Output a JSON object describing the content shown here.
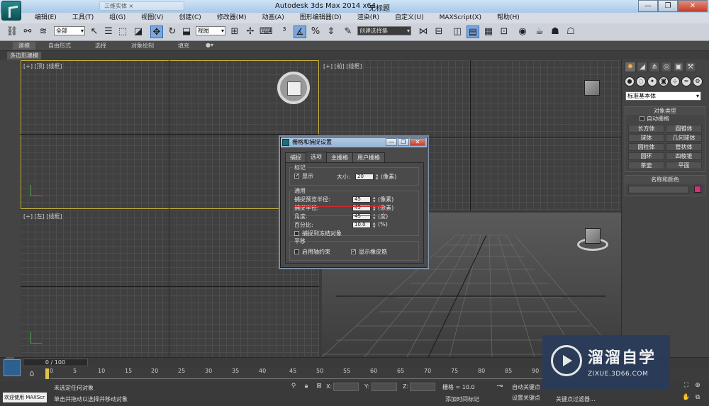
{
  "titlebar": {
    "app_title": "Autodesk 3ds Max  2014 x64",
    "document_name": "无标题",
    "tab_text": "三维实体  ×",
    "window_buttons": [
      "—",
      "❐",
      "✕"
    ]
  },
  "menubar": {
    "items": [
      "编辑(E)",
      "工具(T)",
      "组(G)",
      "视图(V)",
      "创建(C)",
      "修改器(M)",
      "动画(A)",
      "图形编辑器(D)",
      "渲染(R)",
      "自定义(U)",
      "MAXScript(X)",
      "帮助(H)"
    ]
  },
  "toolbar": {
    "selection_filter": "全部",
    "reference_coord": "视图",
    "named_selection": "创建选择集"
  },
  "ribbon": {
    "tabs": [
      "建模",
      "自由形式",
      "选择",
      "对象绘制",
      "填充"
    ],
    "active_tab": "建模",
    "subtab": "多边形建模"
  },
  "viewports": {
    "top": "[+] [顶] [线框]",
    "front": "[+] [前] [线框]",
    "left": "[+] [左] [线框]"
  },
  "dialog": {
    "title": "栅格和捕捉设置",
    "tabs": [
      "捕捉",
      "选项",
      "主栅格",
      "用户栅格"
    ],
    "active_tab": "选项",
    "markers": {
      "group_title": "标记",
      "display_label": "显示",
      "display_checked": true,
      "size_label": "大小:",
      "size_value": "20",
      "size_unit": "(像素)"
    },
    "general": {
      "group_title": "通用",
      "snap_preview_radius_label": "捕捉预览半径:",
      "snap_preview_radius_value": "45",
      "snap_preview_radius_unit": "(像素)",
      "snap_radius_label": "捕捉半径:",
      "snap_radius_value": "45",
      "snap_radius_unit": "(像素)",
      "angle_label": "角度:",
      "angle_value": "45",
      "angle_unit": "(度)",
      "percent_label": "百分比:",
      "percent_value": "10.0",
      "percent_unit": "(%)",
      "snap_frozen_label": "捕捉到冻结对象",
      "snap_frozen_checked": false
    },
    "translation": {
      "group_title": "平移",
      "axis_constraint_label": "启用轴约束",
      "axis_constraint_checked": false,
      "rubber_band_label": "显示橡皮筋",
      "rubber_band_checked": true
    }
  },
  "command_panel": {
    "category": "标准基本体",
    "object_type_title": "对象类型",
    "autogrid_label": "自动栅格",
    "objects": [
      "长方体",
      "圆锥体",
      "球体",
      "几何球体",
      "圆柱体",
      "管状体",
      "圆环",
      "四棱锥",
      "茶壶",
      "平面"
    ],
    "name_color_title": "名称和颜色",
    "object_color": "#d4307a"
  },
  "timeline": {
    "slider_text": "0 / 100",
    "ruler_labels": [
      "0",
      "5",
      "10",
      "15",
      "20",
      "25",
      "30",
      "35",
      "40",
      "45",
      "50",
      "55",
      "60",
      "65",
      "70",
      "75",
      "80",
      "85",
      "90"
    ]
  },
  "statusbar": {
    "welcome": "欢迎使用 MAXScr",
    "selection_status": "未选定任何对象",
    "prompt": "单击并拖动以选择并移动对象",
    "x_label": "X:",
    "y_label": "Y:",
    "z_label": "Z:",
    "grid_text": "栅格 = 10.0",
    "auto_key": "自动关键点",
    "set_key": "设置关键点",
    "add_time_tag": "添加时间标记",
    "key_filter": "关键点过滤器..."
  },
  "watermark": {
    "title": "溜溜自学",
    "url": "ZIXUE.3D66.COM"
  }
}
